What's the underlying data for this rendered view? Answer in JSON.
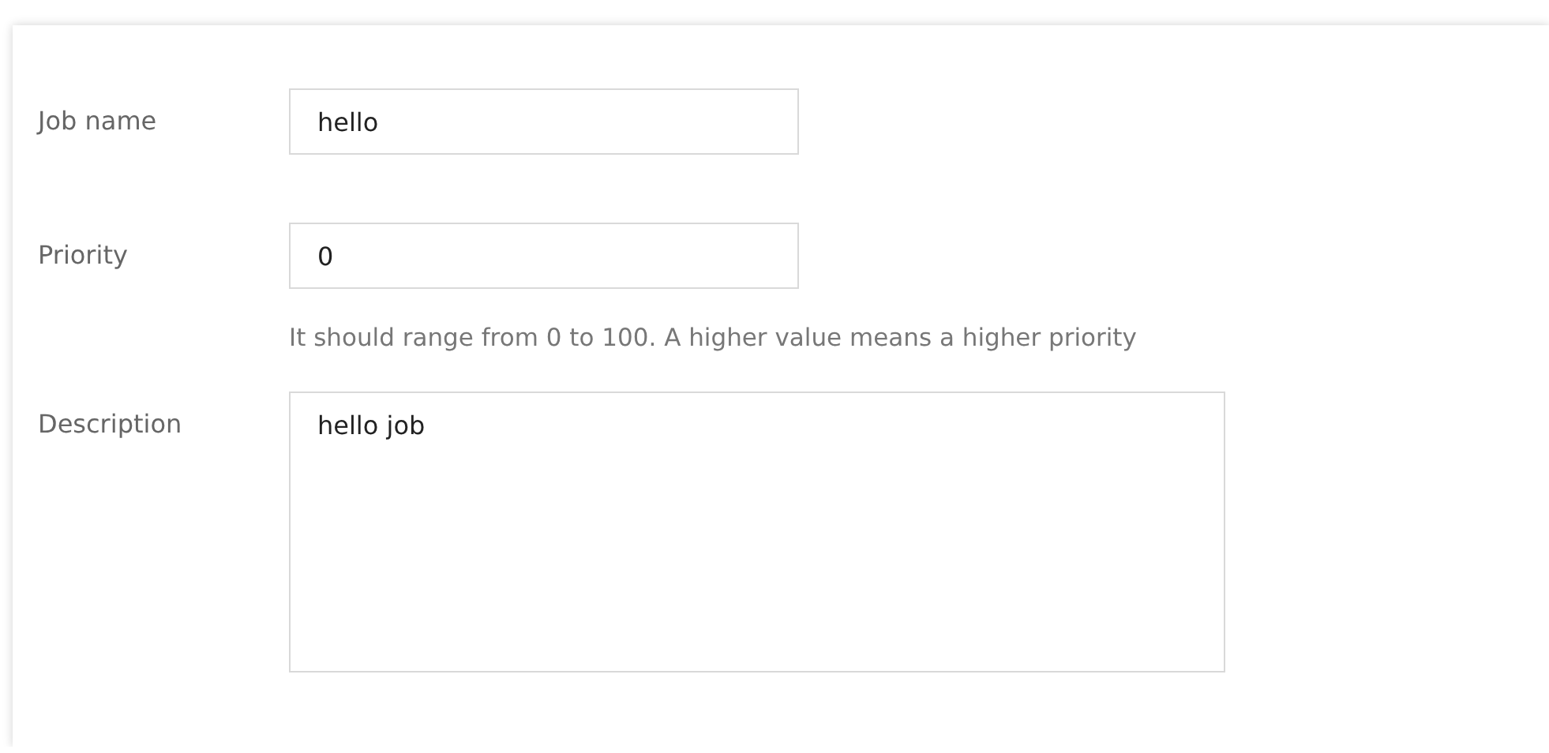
{
  "form": {
    "fields": [
      {
        "kind": "input",
        "label": "Job name",
        "value": "hello"
      },
      {
        "kind": "input",
        "label": "Priority",
        "value": "0",
        "hint": "It should range from 0 to 100. A higher value means a higher priority"
      },
      {
        "kind": "textarea",
        "label": "Description",
        "value": "hello job"
      }
    ]
  }
}
